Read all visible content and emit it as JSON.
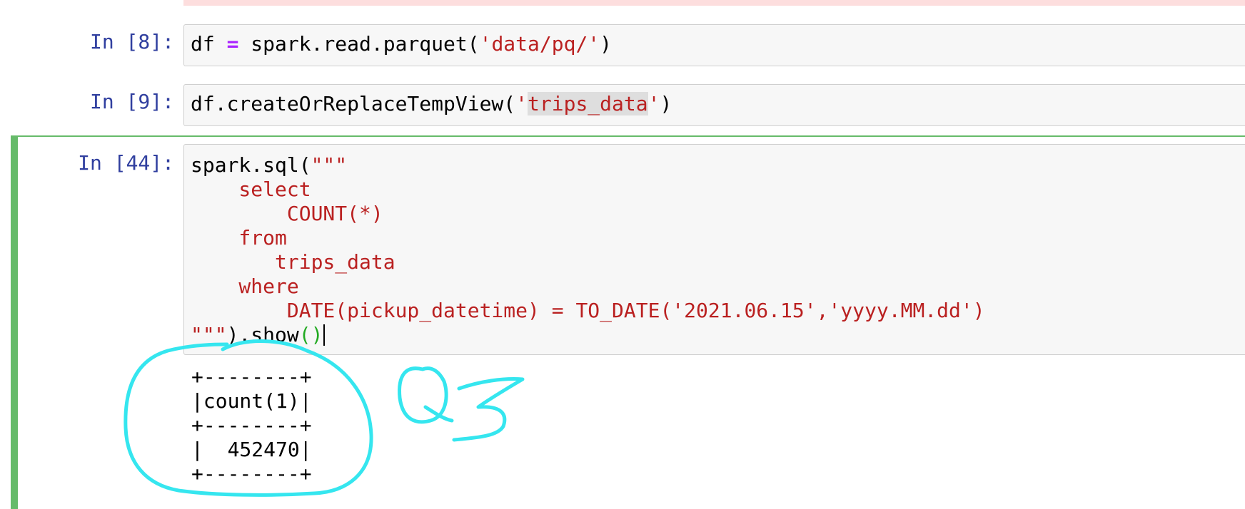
{
  "cells": [
    {
      "prompt": "In [8]:",
      "code_parts": [
        "df ",
        "=",
        " spark.read.parquet(",
        "'data/pq/'",
        ")"
      ]
    },
    {
      "prompt": "In [9]:",
      "code_parts": [
        "df.createOrReplaceTempView(",
        "'",
        "trips_data",
        "'",
        ")"
      ]
    },
    {
      "prompt": "In [44]:",
      "code_lines": [
        "spark.sql(",
        "\"\"\"",
        "    select",
        "        COUNT(*)",
        "    from",
        "       trips_data",
        "    where",
        "        DATE(pickup_datetime) = TO_DATE('2021.06.15','yyyy.MM.dd')",
        "\"\"\"",
        ").show",
        "()"
      ],
      "output_lines": [
        "+--------+",
        "|count(1)|",
        "+--------+",
        "|  452470|",
        "+--------+"
      ]
    }
  ],
  "annotation": {
    "handwritten_label": "Q3",
    "color": "#35e6ef"
  },
  "colors": {
    "prompt": "#303f9f",
    "string": "#ba2121",
    "operator": "#aa22ff",
    "selected_border": "#66bb6a",
    "error_strip": "#fddede"
  }
}
